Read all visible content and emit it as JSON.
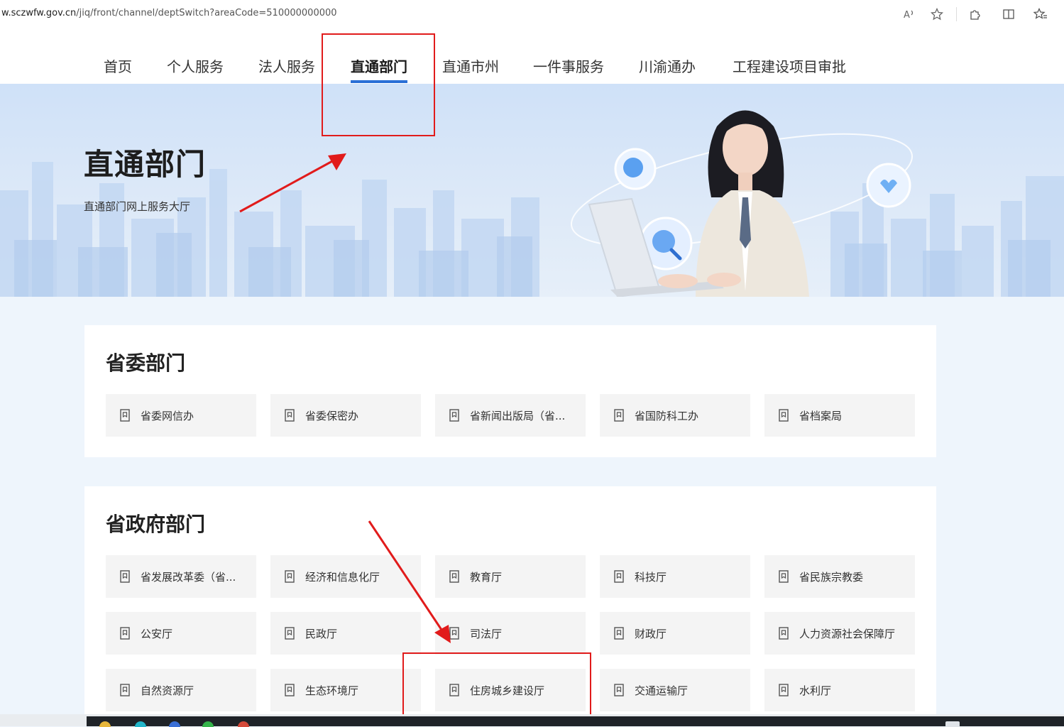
{
  "browser": {
    "url_host": "w.sczwfw.gov.cn",
    "url_path": "/jiq/front/channel/deptSwitch?areaCode=510000000000",
    "icons": [
      "read-aloud-icon",
      "favorite-star-icon",
      "extensions-icon",
      "split-screen-icon",
      "favorites-icon"
    ]
  },
  "nav": {
    "items": [
      {
        "label": "首页"
      },
      {
        "label": "个人服务"
      },
      {
        "label": "法人服务"
      },
      {
        "label": "直通部门",
        "active": true
      },
      {
        "label": "直通市州"
      },
      {
        "label": "一件事服务"
      },
      {
        "label": "川渝通办"
      },
      {
        "label": "工程建设项目审批"
      }
    ]
  },
  "banner": {
    "title": "直通部门",
    "subtitle": "直通部门网上服务大厅"
  },
  "sections": {
    "provincial_committee": {
      "title": "省委部门",
      "items": [
        "省委网信办",
        "省委保密办",
        "省新闻出版局（省...",
        "省国防科工办",
        "省档案局"
      ]
    },
    "provincial_government": {
      "title": "省政府部门",
      "items": [
        "省发展改革委（省...",
        "经济和信息化厅",
        "教育厅",
        "科技厅",
        "省民族宗教委",
        "公安厅",
        "民政厅",
        "司法厅",
        "财政厅",
        "人力资源社会保障厅",
        "自然资源厅",
        "生态环境厅",
        "住房城乡建设厅",
        "交通运输厅",
        "水利厅"
      ]
    }
  },
  "colors": {
    "accent": "#2a6fd6",
    "annotation": "#e11b1b",
    "tile_bg": "#f4f4f4",
    "page_bg": "#eef5fc"
  }
}
